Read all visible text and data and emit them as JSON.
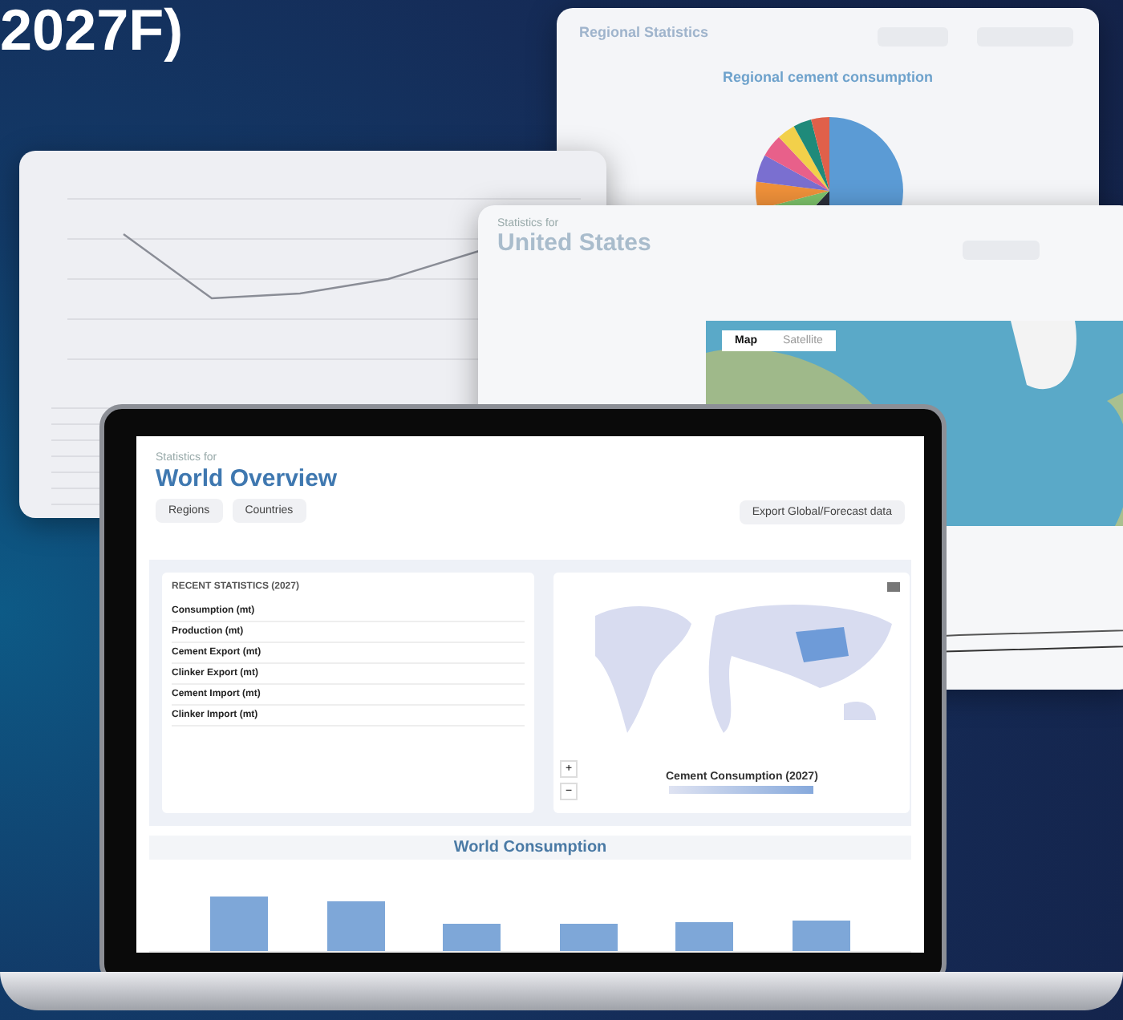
{
  "heading": "2027F)",
  "regional_window": {
    "title": "Regional Statistics",
    "chart_title": "Regional cement consumption"
  },
  "country_window": {
    "caption": "Statistics for",
    "title": "United States",
    "map_tabs": [
      {
        "label": "Map",
        "selected": true
      },
      {
        "label": "Satellite",
        "selected": false
      }
    ]
  },
  "dashboard": {
    "caption": "Statistics for",
    "title": "World Overview",
    "nav_buttons": [
      "Regions",
      "Countries"
    ],
    "export_button": "Export Global/Forecast data",
    "stats": {
      "title": "RECENT STATISTICS (2027)",
      "rows": [
        "Consumption (mt)",
        "Production (mt)",
        "Cement Export (mt)",
        "Clinker Export (mt)",
        "Cement Import (mt)",
        "Clinker Import (mt)"
      ]
    },
    "map": {
      "legend_title": "Cement Consumption (2027)",
      "zoom_buttons": [
        "+",
        "−"
      ]
    },
    "chart": {
      "title": "World Consumption"
    }
  }
}
